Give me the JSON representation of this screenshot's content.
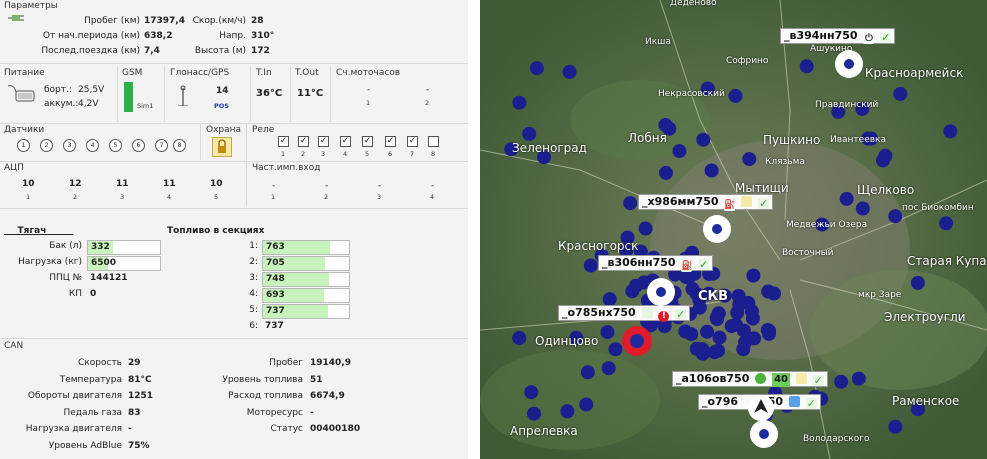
{
  "params": {
    "header": "Параметры",
    "rows": [
      {
        "label": "Пробег (км)",
        "value": "17397,4"
      },
      {
        "label": "От нач.периода (км)",
        "value": "638,2"
      },
      {
        "label": "Послед.поездка (км)",
        "value": "7,4"
      }
    ],
    "rows2": [
      {
        "label": "Скор.(км/ч)",
        "value": "28"
      },
      {
        "label": "Напр.",
        "value": "310°"
      },
      {
        "label": "Высота (м)",
        "value": "172"
      }
    ]
  },
  "power": {
    "header": "Питание",
    "board_label": "борт.:",
    "board_value": "25,5V",
    "battery_label": "аккум.:",
    "battery_value": "4,2V"
  },
  "gsm": {
    "header": "GSM",
    "sim": "Sim1"
  },
  "gnss": {
    "header": "Глонасс/GPS",
    "count": "14",
    "pos": "POS"
  },
  "tin": {
    "header": "T.In",
    "value": "36°C"
  },
  "tout": {
    "header": "T.Out",
    "value": "11°C"
  },
  "moto": {
    "header": "Сч.моточасов",
    "cols": [
      "1",
      "2"
    ],
    "values": [
      "-",
      "-"
    ]
  },
  "sensors": {
    "header": "Датчики",
    "items": [
      "1",
      "2",
      "3",
      "4",
      "5",
      "6",
      "7",
      "8"
    ]
  },
  "guard": {
    "header": "Охрана"
  },
  "relay": {
    "header": "Реле",
    "items": [
      "1",
      "2",
      "3",
      "4",
      "5",
      "6",
      "7",
      "8"
    ],
    "checked": [
      true,
      true,
      true,
      true,
      true,
      true,
      true,
      false
    ],
    "mark": "✓"
  },
  "adc": {
    "header": "АЦП",
    "values": [
      "10",
      "12",
      "11",
      "11",
      "10"
    ],
    "cols": [
      "1",
      "2",
      "3",
      "4",
      "5"
    ]
  },
  "freq": {
    "header": "Част.имп.вход",
    "values": [
      "-",
      "-",
      "-",
      "-"
    ],
    "cols": [
      "1",
      "2",
      "3",
      "4"
    ]
  },
  "truck": {
    "header": "___Тягач______",
    "tank_label": "Бак (л)",
    "tank_value": "332",
    "tank_level": 0.35,
    "load_label": "Нагрузка (кг)",
    "load_value": "6500",
    "load_level": 0.28,
    "ppc_label": "ППЦ №",
    "ppc_value": "144121",
    "kp_label": "КП",
    "kp_value": "0"
  },
  "fuel": {
    "header": "Топливо в секциях",
    "sections": [
      {
        "n": "1:",
        "v": "763",
        "level": 0.78
      },
      {
        "n": "2:",
        "v": "705",
        "level": 0.72
      },
      {
        "n": "3:",
        "v": "748",
        "level": 0.77
      },
      {
        "n": "4:",
        "v": "693",
        "level": 0.71
      },
      {
        "n": "5:",
        "v": "737",
        "level": 0.76
      },
      {
        "n": "6:",
        "v": "737"
      }
    ]
  },
  "can": {
    "header": "CAN",
    "left": [
      {
        "label": "Скорость",
        "value": "29"
      },
      {
        "label": "Температура",
        "value": "81°C"
      },
      {
        "label": "Обороты двигателя",
        "value": "1251"
      },
      {
        "label": "Педаль газа",
        "value": "83"
      },
      {
        "label": "Нагрузка двигателя",
        "value": "-"
      },
      {
        "label": "Уровень AdBlue",
        "value": "75%"
      }
    ],
    "right": [
      {
        "label": "Пробег",
        "value": "19140,9"
      },
      {
        "label": "Уровень топлива",
        "value": "51"
      },
      {
        "label": "Расход топлива",
        "value": "6674,9"
      },
      {
        "label": "Моторесурс",
        "value": "-"
      },
      {
        "label": "Статус",
        "value": "00400180"
      }
    ]
  },
  "map": {
    "places": [
      "Деденово",
      "Икша",
      "Софрино",
      "Некрасовский",
      "Правдинский",
      "Лобня",
      "Пушкино",
      "Ивантеевка",
      "Зеленоград",
      "Клязьма",
      "Мытищи",
      "Щелково",
      "Медвежьи Озера",
      "Красногорск",
      "Восточный",
      "Одинцово",
      "Старая Купавна",
      "Электроугли",
      "Апрелевка",
      "Раменское",
      "Володарского",
      "Ашукино",
      "Красноармейск",
      "пос Биокомбин",
      "мкр Заре"
    ],
    "vehicles": [
      {
        "label": "_в394нн750",
        "s": "⏻",
        "c": "✓"
      },
      {
        "label": "_х986мм750",
        "s": "⛽",
        "c": "✓"
      },
      {
        "label": "_в306нн750",
        "s": "⛽",
        "c": "✓"
      },
      {
        "label": "_о785нх750",
        "s": "!",
        "c": "✓"
      },
      {
        "label": "_а106ов750",
        "speed": "40",
        "c": "✓"
      },
      {
        "label": "_о796",
        "suffix": "50",
        "c": "✓"
      }
    ],
    "skv": "СКВ"
  },
  "colors": {
    "accent": "#1f3a9c",
    "ok": "#6cc15a",
    "alarm": "#e21b2b"
  }
}
